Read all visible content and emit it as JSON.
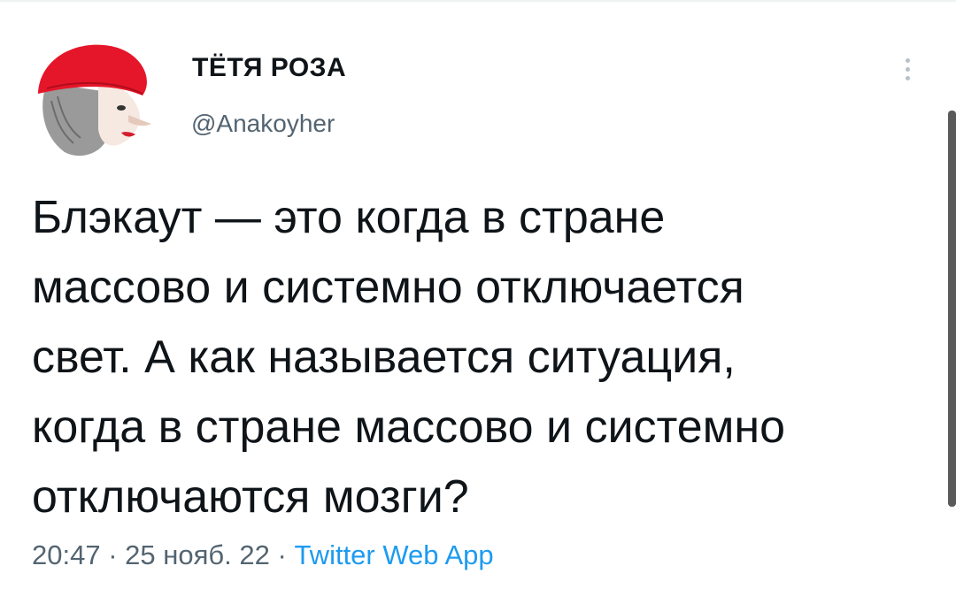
{
  "tweet": {
    "author": {
      "display_name": "ТЁТЯ РОЗА",
      "handle": "@Anakoyher"
    },
    "text": "Блэкаут — это когда в стране\nмассово и системно отключается\nсвет. А как называется ситуация,\nкогда в стране массово и системно\nотключаются мозги?",
    "time": "20:47",
    "date": "25 нояб. 22",
    "separator": "·",
    "source": "Twitter Web App"
  },
  "icons": {
    "more": "more-vertical-icon",
    "avatar": "avatar-red-hat-woman"
  },
  "colors": {
    "text": "#0f1419",
    "secondary": "#536471",
    "link": "#1d9bf0",
    "avatar_hat": "#e5162a"
  }
}
